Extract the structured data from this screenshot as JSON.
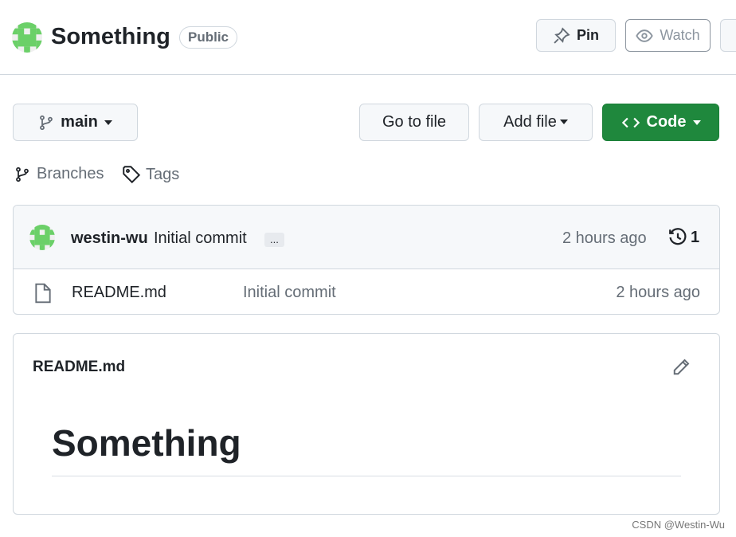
{
  "header": {
    "repo_name": "Something",
    "visibility": "Public",
    "pin_label": "Pin",
    "watch_label": "Watch"
  },
  "toolbar": {
    "branch": "main",
    "go_to_file": "Go to file",
    "add_file": "Add file",
    "code": "Code",
    "branches": "Branches",
    "tags": "Tags"
  },
  "commit": {
    "author": "westin-wu",
    "message": "Initial commit",
    "ellipsis": "...",
    "time": "2 hours ago",
    "count": "1"
  },
  "files": [
    {
      "name": "README.md",
      "message": "Initial commit",
      "time": "2 hours ago"
    }
  ],
  "readme": {
    "title": "README.md",
    "heading": "Something"
  },
  "watermark": "CSDN @Westin-Wu",
  "colors": {
    "accent_green": "#1f883d",
    "avatar_green": "#6bd068"
  }
}
